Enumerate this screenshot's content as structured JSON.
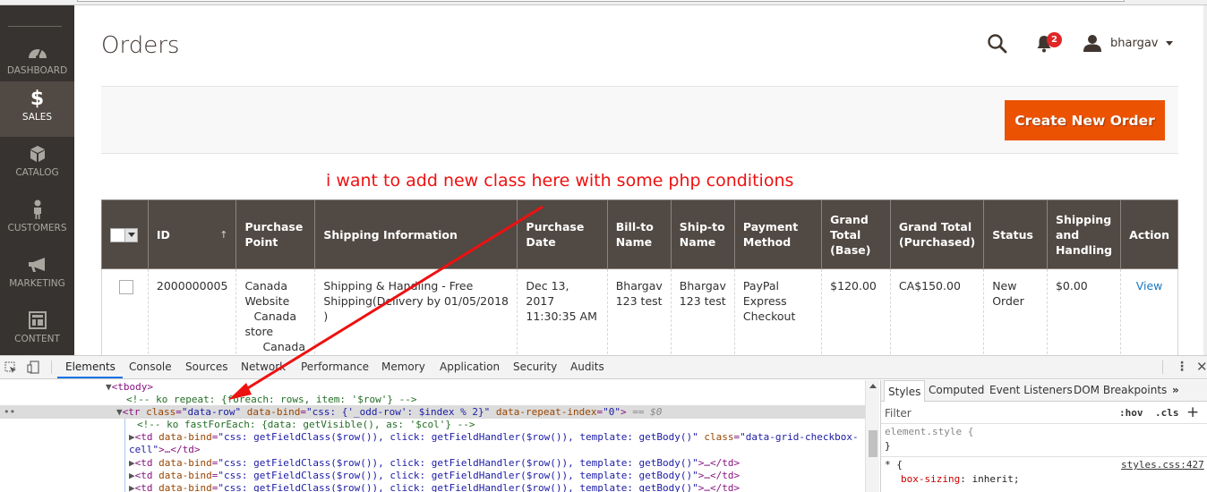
{
  "sidebar": {
    "items": [
      {
        "label": "DASHBOARD",
        "icon": "dashboard-gauge-icon",
        "active": false
      },
      {
        "label": "SALES",
        "icon": "dollar-icon",
        "active": true
      },
      {
        "label": "CATALOG",
        "icon": "box-icon",
        "active": false
      },
      {
        "label": "CUSTOMERS",
        "icon": "person-icon",
        "active": false
      },
      {
        "label": "MARKETING",
        "icon": "megaphone-icon",
        "active": false
      },
      {
        "label": "CONTENT",
        "icon": "layout-icon",
        "active": false
      }
    ]
  },
  "header": {
    "title": "Orders",
    "notification_count": "2",
    "username": "bhargav"
  },
  "actions": {
    "create_label": "Create New Order"
  },
  "annotation": {
    "text": "i want to add new class here with some php conditions",
    "color": "#ee1111"
  },
  "grid": {
    "columns": [
      "ID",
      "Purchase Point",
      "Shipping Information",
      "Purchase Date",
      "Bill-to Name",
      "Ship-to Name",
      "Payment Method",
      "Grand Total (Base)",
      "Grand Total (Purchased)",
      "Status",
      "Shipping and Handling",
      "Action"
    ],
    "column_lines": {
      "purchase_point": [
        "Purchase",
        "Point"
      ],
      "purchase_date": [
        "Purchase",
        "Date"
      ],
      "bill_to": [
        "Bill-to",
        "Name"
      ],
      "ship_to": [
        "Ship-to",
        "Name"
      ],
      "payment": [
        "Payment",
        "Method"
      ],
      "gt_base": [
        "Grand",
        "Total",
        "(Base)"
      ],
      "gt_purchased": [
        "Grand Total",
        "(Purchased)"
      ],
      "shipping_handling": [
        "Shipping",
        "and",
        "Handling"
      ]
    },
    "sort_indicator": "↑",
    "rows": [
      {
        "id": "2000000005",
        "purchase_point": [
          "Canada",
          "Website",
          "Canada",
          "store",
          "Canada"
        ],
        "shipping_information": [
          "Shipping & Handling - Free",
          "Shipping(Delivery by 01/05/2018 )"
        ],
        "purchase_date": [
          "Dec 13, 2017",
          "11:30:35 AM"
        ],
        "bill_to": [
          "Bhargav",
          "123 test"
        ],
        "ship_to": [
          "Bhargav",
          "123 test"
        ],
        "payment_method": [
          "PayPal",
          "Express",
          "Checkout"
        ],
        "grand_total_base": "$120.00",
        "grand_total_purchased": "CA$150.00",
        "status": [
          "New",
          "Order"
        ],
        "shipping_and_handling": "$0.00",
        "action": "View"
      }
    ]
  },
  "devtools": {
    "tabs": [
      "Elements",
      "Console",
      "Sources",
      "Network",
      "Performance",
      "Memory",
      "Application",
      "Security",
      "Audits"
    ],
    "active_tab": "Elements",
    "code": {
      "l1_tag": "<tbody>",
      "l2_comment": "<!-- ko repeat: {foreach: rows, item: '$row'} -->",
      "l3_open": "<tr ",
      "l3_a1": "class",
      "l3_v1": "\"data-row\"",
      "l3_a2": "data-bind",
      "l3_v2": "\"css: {'_odd-row': $index % 2}\"",
      "l3_a3": "data-repeat-index",
      "l3_v3": "\"0\"",
      "l3_close": ">",
      "l3_marker": " == $0",
      "l4_comment": "<!-- ko fastForEach: {data: getVisible(), as: '$col'} -->",
      "td_open": "<td ",
      "td_attr": "data-bind",
      "td_val": "\"css: getFieldClass($row()), click: getFieldHandler($row()), template: getBody()\"",
      "td_class_attr": "class",
      "td_class_val_a": "\"data-grid-checkbox-",
      "td_class_val_b": "cell\"",
      "td_close": ">…</td>"
    },
    "styles": {
      "tabs": [
        "Styles",
        "Computed",
        "Event Listeners",
        "DOM Breakpoints"
      ],
      "more": "»",
      "filter_placeholder": "Filter",
      "hov": ":hov",
      "cls": ".cls",
      "add": "+",
      "rule1_selector": "element.style {",
      "rule1_close": "}",
      "rule2_selector": "* {",
      "rule2_source": "styles.css:427",
      "rule2_prop": "box-sizing",
      "rule2_value": " inherit;"
    }
  }
}
